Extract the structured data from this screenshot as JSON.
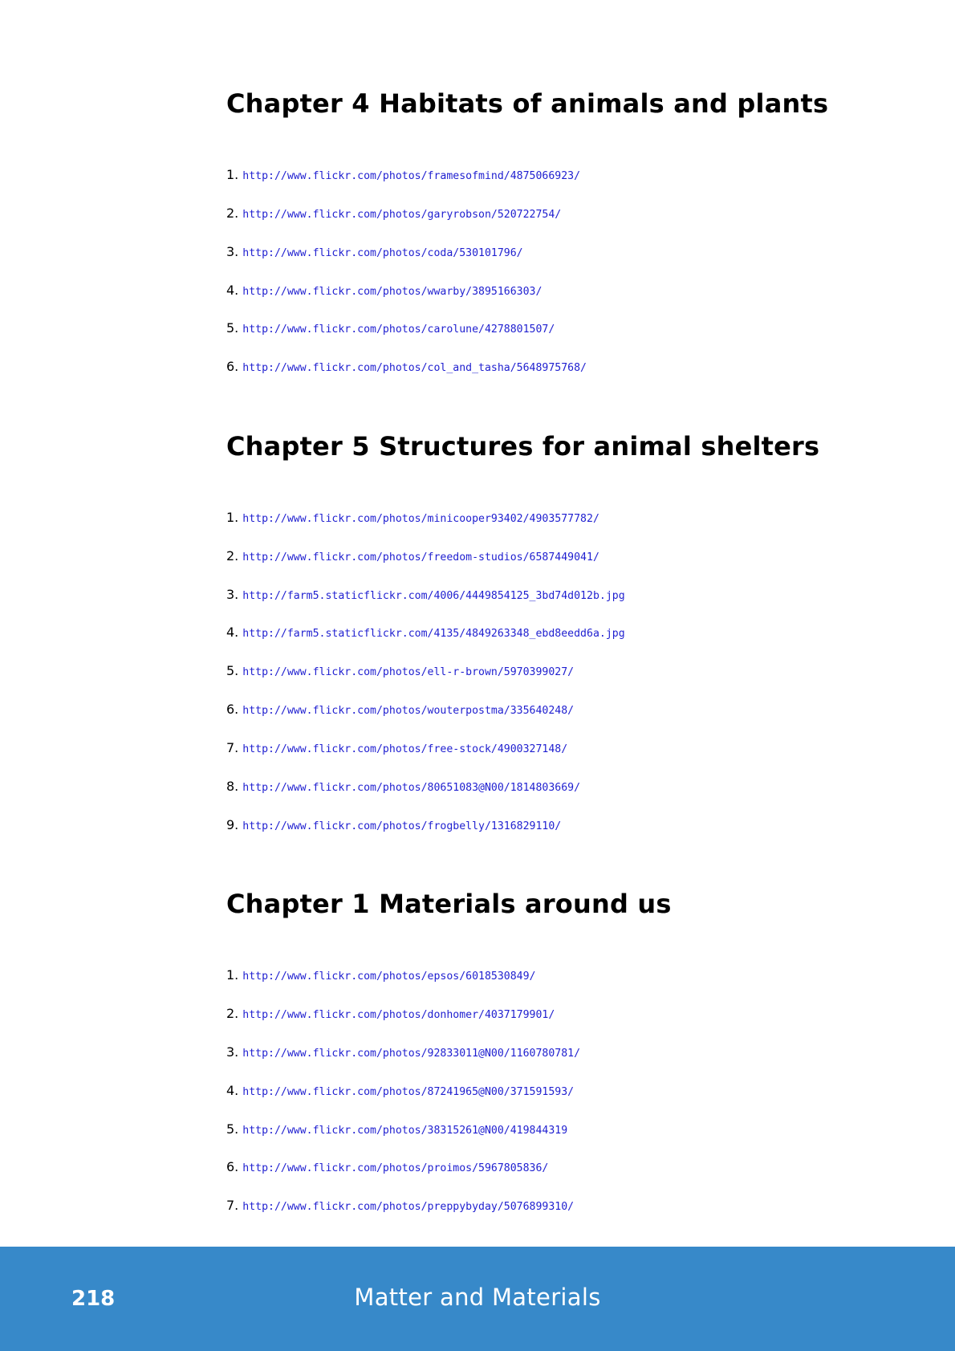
{
  "sections": [
    {
      "title": "Chapter 4 Habitats of animals and plants",
      "refs": [
        {
          "num": "1.",
          "url": "http://www.flickr.com/photos/framesofmind/4875066923/"
        },
        {
          "num": "2.",
          "url": "http://www.flickr.com/photos/garyrobson/520722754/"
        },
        {
          "num": "3.",
          "url": "http://www.flickr.com/photos/coda/530101796/"
        },
        {
          "num": "4.",
          "url": "http://www.flickr.com/photos/wwarby/3895166303/"
        },
        {
          "num": "5.",
          "url": "http://www.flickr.com/photos/carolune/4278801507/"
        },
        {
          "num": "6.",
          "url": "http://www.flickr.com/photos/col_and_tasha/5648975768/"
        }
      ]
    },
    {
      "title": "Chapter 5 Structures for animal shelters",
      "refs": [
        {
          "num": "1.",
          "url": "http://www.flickr.com/photos/minicooper93402/4903577782/"
        },
        {
          "num": "2.",
          "url": "http://www.flickr.com/photos/freedom-studios/6587449041/"
        },
        {
          "num": "3.",
          "url": "http://farm5.staticflickr.com/4006/4449854125_3bd74d012b.jpg"
        },
        {
          "num": "4.",
          "url": "http://farm5.staticflickr.com/4135/4849263348_ebd8eedd6a.jpg"
        },
        {
          "num": "5.",
          "url": "http://www.flickr.com/photos/ell-r-brown/5970399027/"
        },
        {
          "num": "6.",
          "url": "http://www.flickr.com/photos/wouterpostma/335640248/"
        },
        {
          "num": "7.",
          "url": "http://www.flickr.com/photos/free-stock/4900327148/"
        },
        {
          "num": "8.",
          "url": "http://www.flickr.com/photos/80651083@N00/1814803669/"
        },
        {
          "num": "9.",
          "url": "http://www.flickr.com/photos/frogbelly/1316829110/"
        }
      ]
    },
    {
      "title": "Chapter 1 Materials around us",
      "refs": [
        {
          "num": "1.",
          "url": "http://www.flickr.com/photos/epsos/6018530849/"
        },
        {
          "num": "2.",
          "url": "http://www.flickr.com/photos/donhomer/4037179901/"
        },
        {
          "num": "3.",
          "url": "http://www.flickr.com/photos/92833011@N00/1160780781/"
        },
        {
          "num": "4.",
          "url": "http://www.flickr.com/photos/87241965@N00/371591593/"
        },
        {
          "num": "5.",
          "url": "http://www.flickr.com/photos/38315261@N00/419844319"
        },
        {
          "num": "6.",
          "url": "http://www.flickr.com/photos/proimos/5967805836/"
        },
        {
          "num": "7.",
          "url": "http://www.flickr.com/photos/preppybyday/5076899310/"
        }
      ]
    }
  ],
  "footer": {
    "page_number": "218",
    "book_title": "Matter and Materials",
    "background_color": "#3789c9"
  },
  "colors": {
    "link": "#1f1fd0",
    "heading": "#000000"
  }
}
